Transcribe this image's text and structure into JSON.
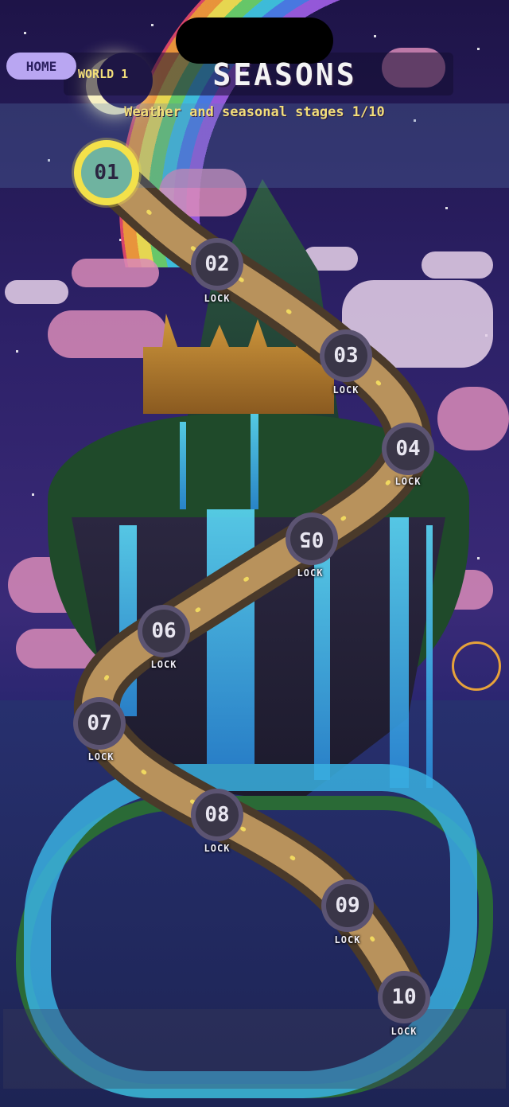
{
  "header": {
    "home_label": "HOME",
    "world_label": "WORLD 1",
    "title": "SEASONS",
    "subtitle": "Weather and seasonal stages 1/10"
  },
  "stages": [
    {
      "number": "01",
      "status": "current",
      "label": ""
    },
    {
      "number": "02",
      "status": "locked",
      "label": "LOCK"
    },
    {
      "number": "03",
      "status": "locked",
      "label": "LOCK"
    },
    {
      "number": "04",
      "status": "locked",
      "label": "LOCK"
    },
    {
      "number": "05",
      "status": "locked",
      "label": "LOCK"
    },
    {
      "number": "06",
      "status": "locked",
      "label": "LOCK"
    },
    {
      "number": "07",
      "status": "locked",
      "label": "LOCK"
    },
    {
      "number": "08",
      "status": "locked",
      "label": "LOCK"
    },
    {
      "number": "09",
      "status": "locked",
      "label": "LOCK"
    },
    {
      "number": "10",
      "status": "locked",
      "label": "LOCK"
    }
  ],
  "colors": {
    "path_outer": "#4a3a2a",
    "path_inner": "#b8925c",
    "path_dots": "#f0d860",
    "current_ring": "#f3e14a",
    "accent_text": "#f2de7a"
  },
  "icons": [
    "moon-icon",
    "rainbow-icon",
    "ferris-wheel-icon"
  ]
}
